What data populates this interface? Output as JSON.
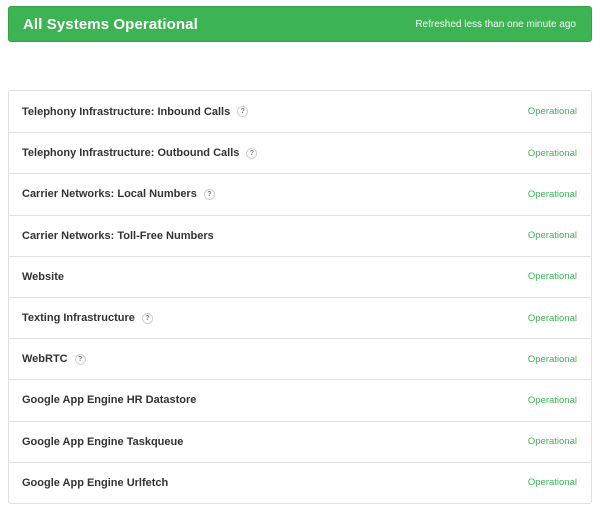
{
  "banner": {
    "title": "All Systems Operational",
    "refreshed": "Refreshed less than one minute ago",
    "color": "#3cb453"
  },
  "components": [
    {
      "name": "Telephony Infrastructure: Inbound Calls",
      "help": "?",
      "status": "Operational"
    },
    {
      "name": "Telephony Infrastructure: Outbound Calls",
      "help": "?",
      "status": "Operational"
    },
    {
      "name": "Carrier Networks: Local Numbers",
      "help": "?",
      "status": "Operational"
    },
    {
      "name": "Carrier Networks: Toll-Free Numbers",
      "help": "",
      "status": "Operational"
    },
    {
      "name": "Website",
      "help": "",
      "status": "Operational"
    },
    {
      "name": "Texting Infrastructure",
      "help": "?",
      "status": "Operational"
    },
    {
      "name": "WebRTC",
      "help": "?",
      "status": "Operational"
    },
    {
      "name": "Google App Engine HR Datastore",
      "help": "",
      "status": "Operational"
    },
    {
      "name": "Google App Engine Taskqueue",
      "help": "",
      "status": "Operational"
    },
    {
      "name": "Google App Engine Urlfetch",
      "help": "",
      "status": "Operational"
    }
  ]
}
